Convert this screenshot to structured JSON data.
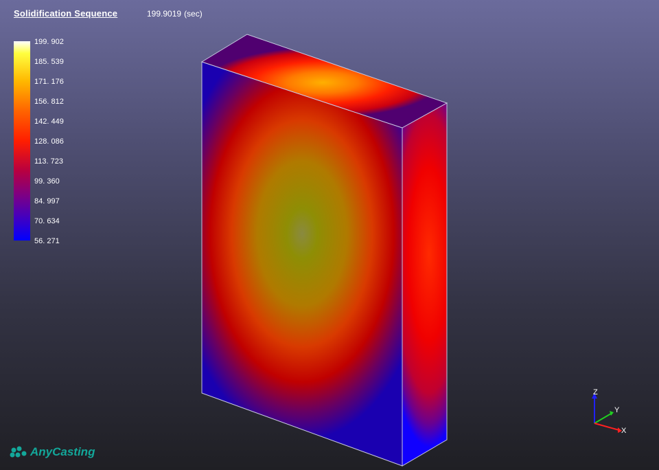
{
  "header": {
    "title": "Solidification Sequence",
    "time_value": "199.9019",
    "time_unit": "(sec)"
  },
  "legend": {
    "ticks": [
      "199. 902",
      "185. 539",
      "171. 176",
      "156. 812",
      "142. 449",
      "128. 086",
      "113. 723",
      "99. 360",
      "84. 997",
      "70. 634",
      "56. 271"
    ]
  },
  "axes": {
    "z_label": "Z",
    "y_label": "Y",
    "x_label": "X",
    "colors": {
      "z": "#2020ff",
      "y": "#20d020",
      "x": "#ff2020"
    }
  },
  "brand": {
    "name": "AnyCasting"
  }
}
